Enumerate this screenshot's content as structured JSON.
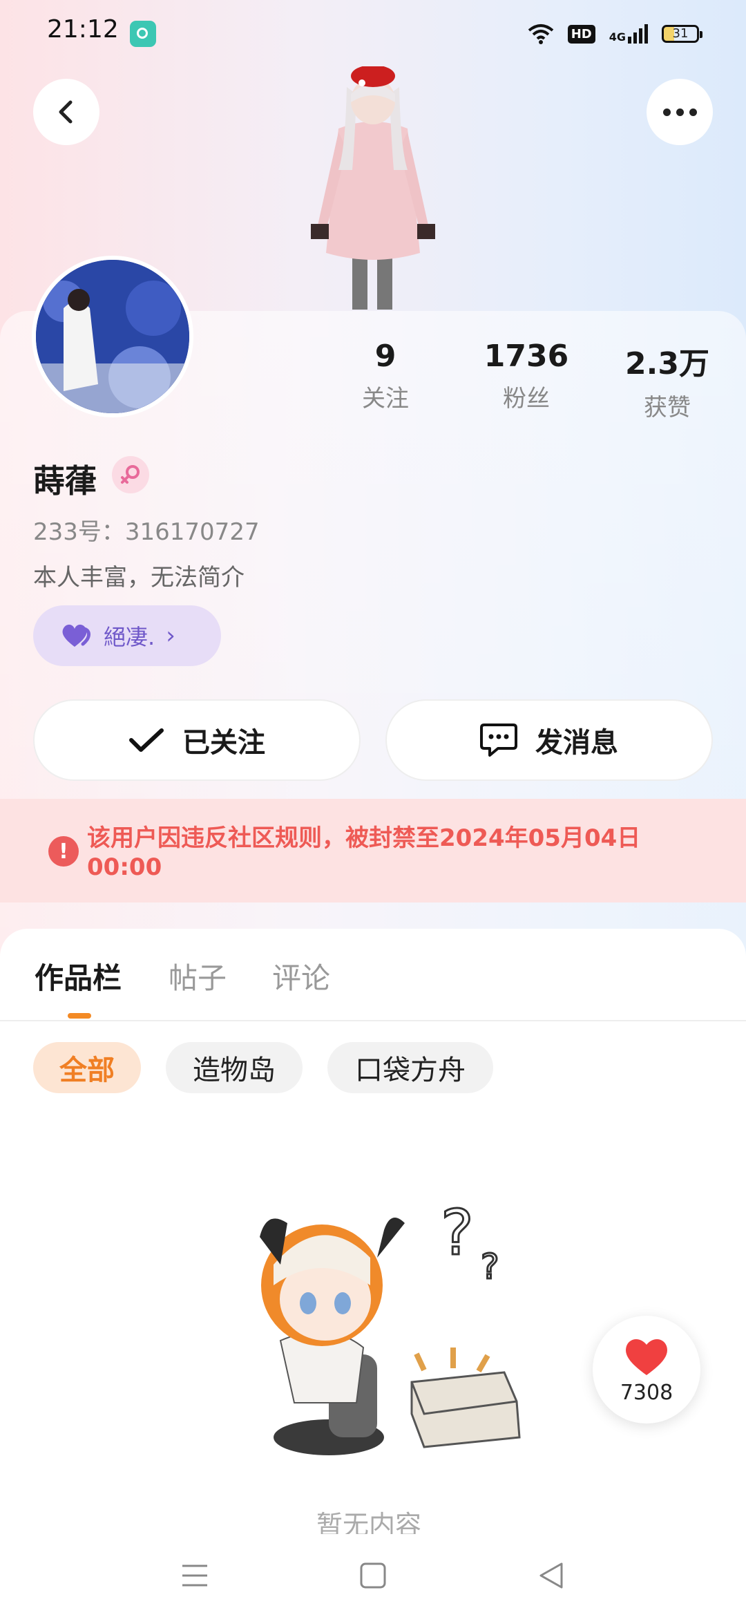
{
  "status_bar": {
    "time": "21:12",
    "hd": "HD",
    "network": "4G",
    "battery": "31"
  },
  "profile": {
    "username": "蒔葎",
    "uid": "233号：316170727",
    "bio": "本人丰富，无法简介",
    "tag": "絕凄.",
    "stats": [
      {
        "value": "9",
        "label": "关注"
      },
      {
        "value": "1736",
        "label": "粉丝"
      },
      {
        "value": "2.3万",
        "label": "获赞"
      }
    ]
  },
  "actions": {
    "follow_label": "已关注",
    "message_label": "发消息"
  },
  "ban_notice": "该用户因违反社区规则，被封禁至2024年05月04日00:00",
  "tabs": [
    {
      "label": "作品栏",
      "active": true
    },
    {
      "label": "帖子",
      "active": false
    },
    {
      "label": "评论",
      "active": false
    }
  ],
  "filters": [
    {
      "label": "全部",
      "active": true
    },
    {
      "label": "造物岛",
      "active": false
    },
    {
      "label": "口袋方舟",
      "active": false
    }
  ],
  "empty_text": "暂无内容",
  "like_count": "7308",
  "colors": {
    "accent": "#f07f24",
    "ban": "#ee5a55",
    "tag": "#6f58c9"
  }
}
